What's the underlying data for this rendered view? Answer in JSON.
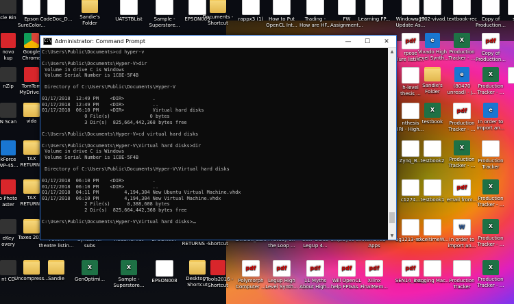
{
  "desktop": {
    "icons": [
      {
        "label": "cle Bin",
        "glyph": "",
        "kind": "g-dark"
      },
      {
        "label": "Epson\nSureColor...",
        "glyph": "",
        "kind": "g-doc"
      },
      {
        "label": "CodeDoc_D...",
        "glyph": "",
        "kind": "g-doc"
      },
      {
        "label": "Sandie's\nFolder",
        "glyph": "",
        "kind": "g-folder"
      },
      {
        "label": "UATSTBList",
        "glyph": "",
        "kind": "g-doc"
      },
      {
        "label": "Sample -\nSuperstore...",
        "glyph": "",
        "kind": "g-doc"
      },
      {
        "label": "EPSON009",
        "glyph": "",
        "kind": "g-doc"
      },
      {
        "label": "Documents -\nShortcut",
        "glyph": "",
        "kind": "g-folder"
      },
      {
        "label": "rappx3 (1)",
        "glyph": "",
        "kind": "g-doc"
      },
      {
        "label": "How to Put\nOpenCL Int...",
        "glyph": "",
        "kind": "g-doc"
      },
      {
        "label": "Trading -\nHow are HF...",
        "glyph": "",
        "kind": "g-doc"
      },
      {
        "label": "FW\nAssignment...",
        "glyph": "",
        "kind": "g-doc"
      },
      {
        "label": "Learning FP...",
        "glyph": "",
        "kind": "g-doc"
      },
      {
        "label": "Windows 10\nUpdate As...",
        "glyph": "",
        "kind": "g-doc"
      },
      {
        "label": "ug902-vivad...",
        "glyph": "",
        "kind": "g-doc"
      },
      {
        "label": "textbook-rec",
        "glyph": "",
        "kind": "g-doc"
      },
      {
        "label": "Copy of\nProduction...",
        "glyph": "",
        "kind": "g-doc"
      },
      {
        "label": "ska",
        "glyph": "",
        "kind": "g-doc"
      },
      {
        "label": "novo\nkup",
        "glyph": "",
        "kind": "g-red"
      },
      {
        "label": "Google\nChrome",
        "glyph": "",
        "kind": "g-chrome"
      },
      {
        "label": "rpose\nlure listin...",
        "glyph": "pdf",
        "kind": "g-pdf"
      },
      {
        "label": "Vivado High\nLevel Synth...",
        "glyph": "e",
        "kind": "g-ie"
      },
      {
        "label": "Production\nTracker - ...",
        "glyph": "X",
        "kind": "g-xl"
      },
      {
        "label": "Copy of\nProduction...",
        "glyph": "pdf",
        "kind": "g-pdf"
      },
      {
        "label": "nZip",
        "glyph": "",
        "kind": "g-dark"
      },
      {
        "label": "TomTom\nMyDrive...",
        "glyph": "",
        "kind": "g-red"
      },
      {
        "label": "h-level\nthesis ...",
        "glyph": "",
        "kind": "g-doc"
      },
      {
        "label": "Sandie's\nFolder",
        "glyph": "",
        "kind": "g-folder"
      },
      {
        "label": "(80470\nunread) - j...",
        "glyph": "e",
        "kind": "g-ie"
      },
      {
        "label": "Production\nTracker - ...",
        "glyph": "X",
        "kind": "g-xl"
      },
      {
        "label": "Tr",
        "glyph": "",
        "kind": "g-doc"
      },
      {
        "label": "N Scan",
        "glyph": "",
        "kind": "g-dark"
      },
      {
        "label": "vida",
        "glyph": "",
        "kind": "g-folder"
      },
      {
        "label": "nthesis\nIRI - High...",
        "glyph": "",
        "kind": "g-doc"
      },
      {
        "label": "testbook",
        "glyph": "X",
        "kind": "g-xl"
      },
      {
        "label": "Production\nTracker - ...",
        "glyph": "pdf",
        "kind": "g-pdf"
      },
      {
        "label": "In order to\nimport an...",
        "glyph": "e",
        "kind": "g-ie"
      },
      {
        "label": "kForce\nWP-45...",
        "glyph": "",
        "kind": "g-ie"
      },
      {
        "label": "TAX\nRETURNS",
        "glyph": "",
        "kind": "g-folder"
      },
      {
        "label": "Zynq_B...",
        "glyph": "",
        "kind": "g-doc"
      },
      {
        "label": "testbook2",
        "glyph": "",
        "kind": "g-doc"
      },
      {
        "label": "Production\nTracker - ...",
        "glyph": "X",
        "kind": "g-xl"
      },
      {
        "label": "Production\nTracker",
        "glyph": "",
        "kind": "g-doc"
      },
      {
        "label": "o Photo\naster",
        "glyph": "",
        "kind": "g-red"
      },
      {
        "label": "TAX\nRETURNS",
        "glyph": "",
        "kind": "g-folder"
      },
      {
        "label": "c1274...",
        "glyph": "",
        "kind": "g-doc"
      },
      {
        "label": "testbook1",
        "glyph": "",
        "kind": "g-doc"
      },
      {
        "label": "email from...",
        "glyph": "pdf",
        "kind": "g-pdf"
      },
      {
        "label": "Production\nTracker - ...",
        "glyph": "X",
        "kind": "g-xl"
      },
      {
        "label": "eKey\novery",
        "glyph": "",
        "kind": "g-dark"
      },
      {
        "label": "Taxes 2016",
        "glyph": "",
        "kind": "g-folder"
      },
      {
        "label": "70mm\ntheatre listin...",
        "glyph": "",
        "kind": "g-doc"
      },
      {
        "label": "Syntax for\nsubs",
        "glyph": "",
        "kind": "g-doc"
      },
      {
        "label": "ReadMeFirst",
        "glyph": "",
        "kind": "g-doc"
      },
      {
        "label": "EPSON007",
        "glyph": "",
        "kind": "g-doc"
      },
      {
        "label": "TAX\nRETURNS -...",
        "glyph": "",
        "kind": "g-folder"
      },
      {
        "label": "vida -\nShortcut",
        "glyph": "",
        "kind": "g-folder"
      },
      {
        "label": "division_da...",
        "glyph": "",
        "kind": "g-doc"
      },
      {
        "label": "A Study on\nthe Loop ...",
        "glyph": "",
        "kind": "g-doc"
      },
      {
        "label": "User Guide\nLegUp 4...",
        "glyph": "",
        "kind": "g-doc"
      },
      {
        "label": "employee c...",
        "glyph": "",
        "kind": "g-doc"
      },
      {
        "label": "Removed\nApps",
        "glyph": "",
        "kind": "g-doc"
      },
      {
        "label": "ug1213-sd...",
        "glyph": "",
        "kind": "g-doc"
      },
      {
        "label": "exceltimeW...",
        "glyph": "",
        "kind": "g-doc"
      },
      {
        "label": "In order to\nimport an...",
        "glyph": "W",
        "kind": "g-word"
      },
      {
        "label": "Production\nTracker - ...",
        "glyph": "X",
        "kind": "g-xl"
      },
      {
        "label": "nt CD",
        "glyph": "",
        "kind": "g-dark"
      },
      {
        "label": "Uncompress...",
        "glyph": "",
        "kind": "g-folder"
      },
      {
        "label": "Sandie",
        "glyph": "",
        "kind": "g-folder"
      },
      {
        "label": "GenOptimi...",
        "glyph": "X",
        "kind": "g-xl"
      },
      {
        "label": "Sample -\nSuperstore...",
        "glyph": "X",
        "kind": "g-xl"
      },
      {
        "label": "EPSON008",
        "glyph": "",
        "kind": "g-doc"
      },
      {
        "label": "Desktop -\nShortcut",
        "glyph": "",
        "kind": "g-folder"
      },
      {
        "label": "VTools2016 -\nShortcut",
        "glyph": "",
        "kind": "g-red"
      },
      {
        "label": "Polymorph\nComputer ...",
        "glyph": "pdf",
        "kind": "g-pdf"
      },
      {
        "label": "Legup High\nLevel Synth...",
        "glyph": "pdf",
        "kind": "g-pdf"
      },
      {
        "label": "11 Myths\nAbout High...",
        "glyph": "pdf",
        "kind": "g-pdf"
      },
      {
        "label": "Will OpenCL\nhelp FPGAs...",
        "glyph": "pdf",
        "kind": "g-pdf"
      },
      {
        "label": "Xilinx\nFinalMem...",
        "glyph": "pdf",
        "kind": "g-pdf"
      },
      {
        "label": "SEN14_Ext...",
        "glyph": "pdf",
        "kind": "g-pdf"
      },
      {
        "label": "nagging Mac...",
        "glyph": "",
        "kind": "g-doc"
      },
      {
        "label": "Production\nTracker",
        "glyph": "",
        "kind": "g-nvidia"
      },
      {
        "label": "Production\nTracker - ...",
        "glyph": "X",
        "kind": "g-xl"
      }
    ]
  },
  "console": {
    "title": "Administrator: Command Prompt",
    "app_icon_text": "C:\\",
    "minimize": "—",
    "maximize": "☐",
    "close": "✕",
    "scroll_up": "▲",
    "scroll_down": "▼",
    "text": "C:\\Users\\Public\\Documents>cd hyper-v\n\nC:\\Users\\Public\\Documents\\Hyper-V>dir\n Volume in drive C is Windows\n Volume Serial Number is 1C8E-5F4B\n\n Directory of C:\\Users\\Public\\Documents\\Hyper-V\n\n01/17/2018  12:49 PM    <DIR>          .\n01/17/2018  12:49 PM    <DIR>          ..\n01/17/2018  06:10 PM    <DIR>          Virtual hard disks\n               0 File(s)              0 bytes\n               3 Dir(s)  825,664,442,368 bytes free\n\nC:\\Users\\Public\\Documents\\Hyper-V>cd virtual hard disks\n\nC:\\Users\\Public\\Documents\\Hyper-V\\Virtual hard disks>dir\n Volume in drive C is Windows\n Volume Serial Number is 1C8E-5F4B\n\n Directory of C:\\Users\\Public\\Documents\\Hyper-V\\Virtual hard disks\n\n01/17/2018  06:10 PM    <DIR>          .\n01/17/2018  06:10 PM    <DIR>          ..\n01/17/2018  04:11 PM         4,194,304 New Ubuntu Virtual Machine.vhdx\n01/17/2018  06:10 PM         4,194,304 New Virtual Machine.vhdx\n               2 File(s)      8,388,608 bytes\n               2 Dir(s)  825,664,442,368 bytes free\n\nC:\\Users\\Public\\Documents\\Hyper-V\\Virtual hard disks>"
  }
}
